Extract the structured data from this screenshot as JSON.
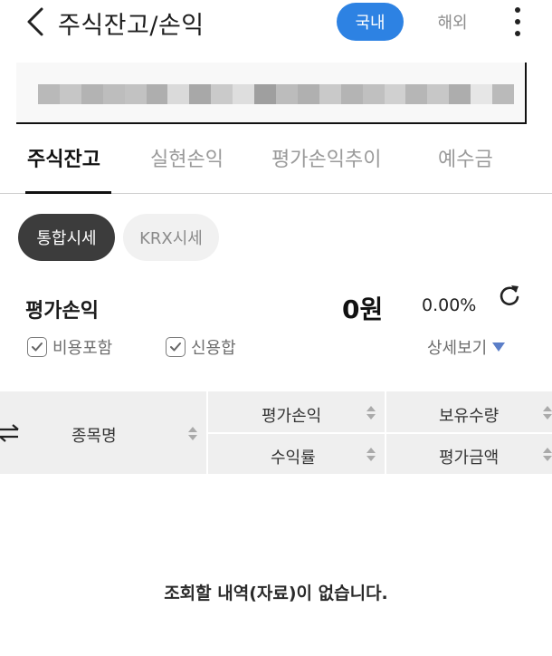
{
  "header": {
    "title": "주식잔고/손익",
    "segment_domestic": "국내",
    "segment_overseas": "해외"
  },
  "tabs": [
    {
      "label": "주식잔고",
      "active": true
    },
    {
      "label": "실현손익",
      "active": false
    },
    {
      "label": "평가손익추이",
      "active": false
    },
    {
      "label": "예수금",
      "active": false
    }
  ],
  "chips": {
    "integrated": "통합시세",
    "krx": "KRX시세"
  },
  "summary": {
    "label": "평가손익",
    "amount": "0원",
    "rate": "0.00%"
  },
  "options": {
    "include_fees": "비용포함",
    "credit_sum": "신용합",
    "detail": "상세보기"
  },
  "table": {
    "col_name": "종목명",
    "col_eval_pl": "평가손익",
    "col_return": "수익률",
    "col_qty": "보유수량",
    "col_eval_amount": "평가금액"
  },
  "empty_message": "조회할 내역(자료)이 없습니다.",
  "colors": {
    "accent": "#2d82e3",
    "chip_dark": "#3c3c3c",
    "detail_arrow": "#5b7ec8"
  }
}
